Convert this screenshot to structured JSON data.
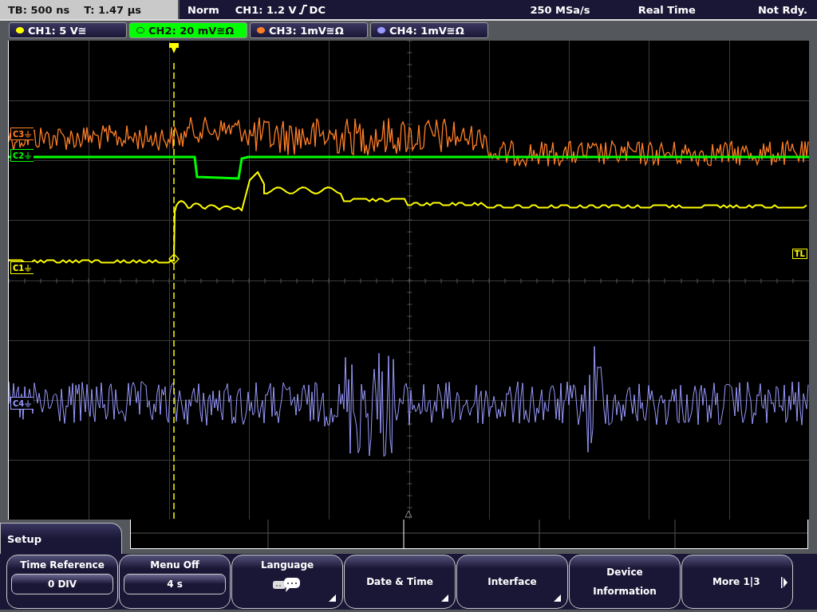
{
  "status_bar": {
    "timebase": "TB: 500 ns",
    "time": "T: 1.47 µs",
    "mode": "Norm",
    "trigger_source": "CH1: 1.2 V",
    "trigger_coupling": "DC",
    "sample_rate": "250 MSa/s",
    "acquisition": "Real Time",
    "state": "Not Rdy."
  },
  "channels": [
    {
      "label": "CH1: 5 V≅",
      "color": "#ffff00",
      "selected": false
    },
    {
      "label": "CH2: 20 mV≅Ω",
      "color": "#00ff00",
      "selected": true
    },
    {
      "label": "CH3: 1mV≅Ω",
      "color": "#ff7f27",
      "selected": false
    },
    {
      "label": "CH4: 1mV≅Ω",
      "color": "#9a9aff",
      "selected": false
    }
  ],
  "markers": [
    {
      "label": "C3",
      "color": "#ff7f27"
    },
    {
      "label": "C2",
      "color": "#00ff00"
    },
    {
      "label": "C1",
      "color": "#ffff00"
    },
    {
      "label": "C4",
      "color": "#9a9aff"
    }
  ],
  "trigger_level_marker": {
    "label": "TL"
  },
  "menu": {
    "title": "Setup",
    "buttons": [
      {
        "kind": "value",
        "label": "Time Reference",
        "value": "0 DIV"
      },
      {
        "kind": "value",
        "label": "Menu Off",
        "value": "4 s"
      },
      {
        "kind": "icon",
        "label": "Language",
        "submenu": true
      },
      {
        "kind": "plain",
        "label": "Date & Time",
        "submenu": true
      },
      {
        "kind": "plain",
        "label": "Interface",
        "submenu": true
      },
      {
        "kind": "plain",
        "label": "Device Information",
        "submenu": false
      },
      {
        "kind": "next",
        "label": "More 1|3",
        "submenu": false
      }
    ]
  }
}
